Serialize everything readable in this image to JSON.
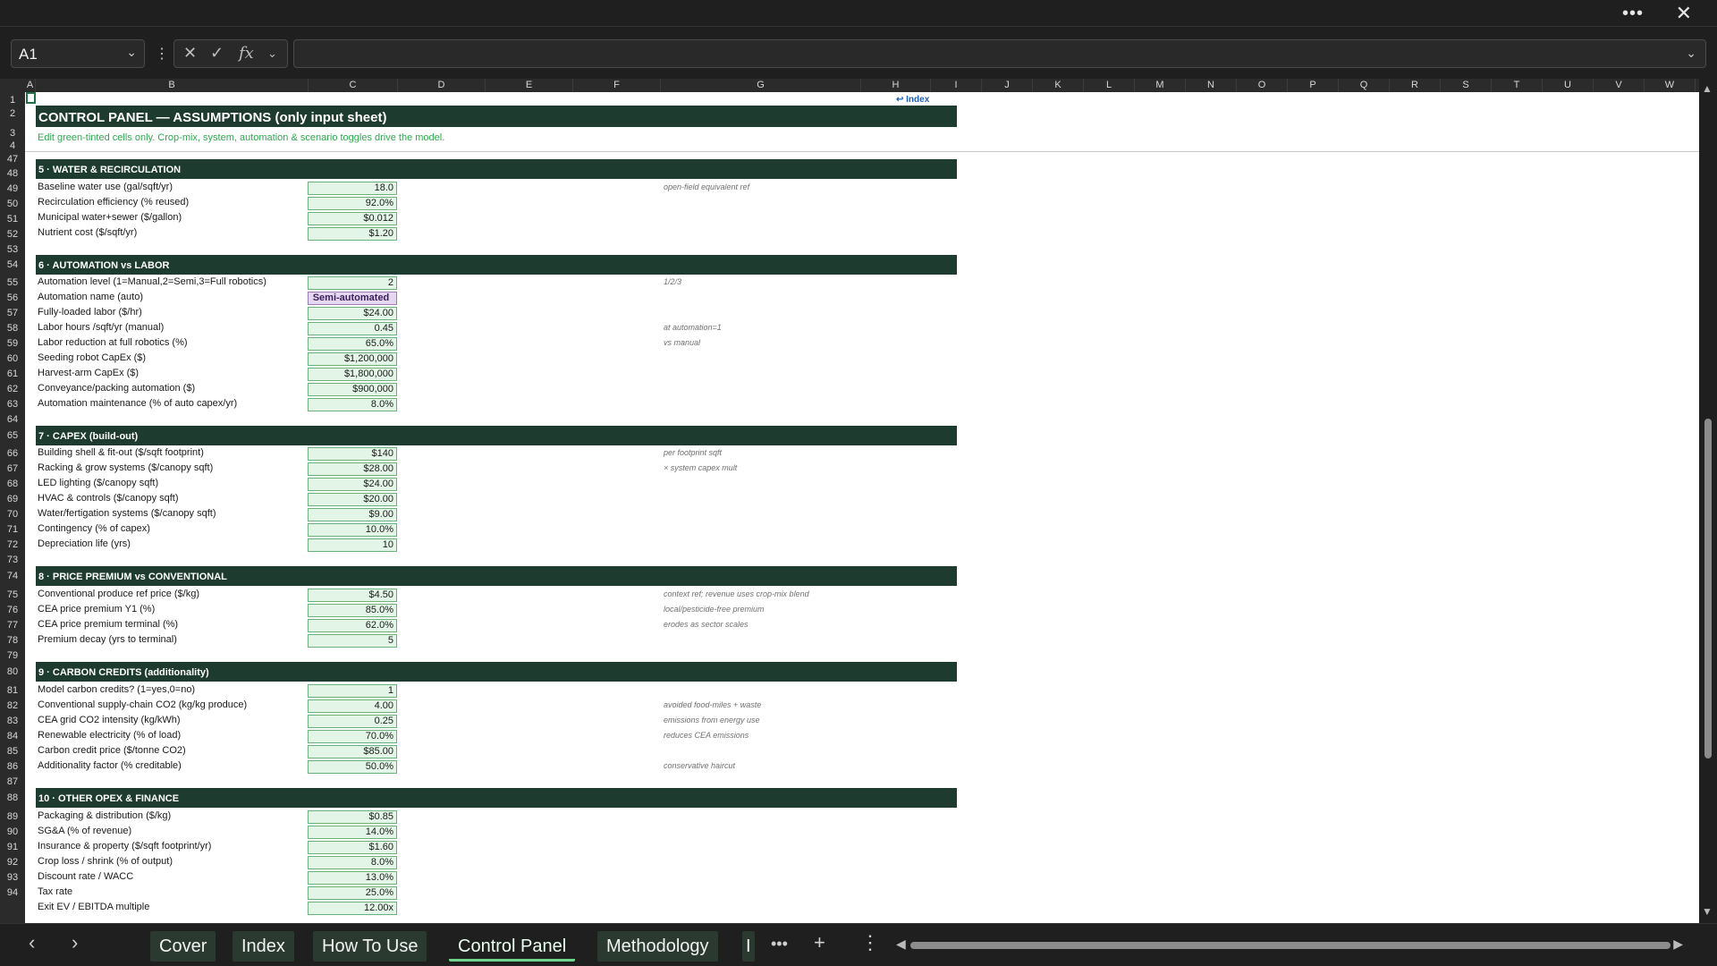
{
  "window": {
    "more_icon": "more-horizontal-icon",
    "close_icon": "close-icon"
  },
  "formula_bar": {
    "name_box": "A1",
    "formula": ""
  },
  "columns": [
    "A",
    "B",
    "C",
    "D",
    "E",
    "F",
    "G",
    "H",
    "I",
    "J",
    "K",
    "L",
    "M",
    "N",
    "O",
    "P",
    "Q",
    "R",
    "S",
    "T",
    "U",
    "V",
    "W"
  ],
  "rows": [
    "1",
    "2",
    "3",
    "4",
    "47",
    "48",
    "49",
    "50",
    "51",
    "52",
    "53",
    "54",
    "55",
    "56",
    "57",
    "58",
    "59",
    "60",
    "61",
    "62",
    "63",
    "64",
    "65",
    "66",
    "67",
    "68",
    "69",
    "70",
    "71",
    "72",
    "73",
    "74",
    "75",
    "76",
    "77",
    "78",
    "79",
    "80",
    "81",
    "82",
    "83",
    "84",
    "85",
    "86",
    "87",
    "88",
    "89",
    "90",
    "91",
    "92",
    "93",
    "94"
  ],
  "sheet": {
    "index_link": "↩ Index",
    "title": "CONTROL PANEL — ASSUMPTIONS (only input sheet)",
    "subtitle": "Edit green-tinted cells only. Crop-mix, system, automation & scenario toggles drive the model.",
    "s5": {
      "header": "5 · WATER & RECIRCULATION",
      "labels": [
        "Baseline water use (gal/sqft/yr)",
        "Recirculation efficiency (% reused)",
        "Municipal water+sewer ($/gallon)",
        "Nutrient cost ($/sqft/yr)"
      ],
      "values": [
        "18.0",
        "92.0%",
        "$0.012",
        "$1.20"
      ],
      "note1": "open-field equivalent ref"
    },
    "s6": {
      "header": "6 · AUTOMATION vs LABOR",
      "labels": [
        "Automation level (1=Manual,2=Semi,3=Full robotics)",
        "Automation name (auto)",
        "Fully-loaded labor ($/hr)",
        "Labor hours /sqft/yr (manual)",
        "Labor reduction at full robotics (%)",
        "Seeding robot CapEx ($)",
        "Harvest-arm CapEx ($)",
        "Conveyance/packing automation ($)",
        "Automation maintenance (% of auto capex/yr)"
      ],
      "values": [
        "2",
        "Semi-automated",
        "$24.00",
        "0.45",
        "65.0%",
        "$1,200,000",
        "$1,800,000",
        "$900,000",
        "8.0%"
      ],
      "notes": [
        "1/2/3",
        "at automation=1",
        "vs manual"
      ]
    },
    "s7": {
      "header": "7 · CAPEX (build-out)",
      "labels": [
        "Building shell & fit-out ($/sqft footprint)",
        "Racking & grow systems ($/canopy sqft)",
        "LED lighting ($/canopy sqft)",
        "HVAC & controls ($/canopy sqft)",
        "Water/fertigation systems ($/canopy sqft)",
        "Contingency (% of capex)",
        "Depreciation life (yrs)"
      ],
      "values": [
        "$140",
        "$28.00",
        "$24.00",
        "$20.00",
        "$9.00",
        "10.0%",
        "10"
      ],
      "notes": [
        "per footprint sqft",
        "× system capex mult"
      ]
    },
    "s8": {
      "header": "8 · PRICE PREMIUM vs CONVENTIONAL",
      "labels": [
        "Conventional produce ref price ($/kg)",
        "CEA price premium Y1 (%)",
        "CEA price premium terminal (%)",
        "Premium decay (yrs to terminal)"
      ],
      "values": [
        "$4.50",
        "85.0%",
        "62.0%",
        "5"
      ],
      "notes": [
        "context ref; revenue uses crop-mix blend",
        "local/pesticide-free premium",
        "erodes as sector scales"
      ]
    },
    "s9": {
      "header": "9 · CARBON CREDITS (additionality)",
      "labels": [
        "Model carbon credits? (1=yes,0=no)",
        "Conventional supply-chain CO2 (kg/kg produce)",
        "CEA grid CO2 intensity (kg/kWh)",
        "Renewable electricity (% of load)",
        "Carbon credit price ($/tonne CO2)",
        "Additionality factor (% creditable)"
      ],
      "values": [
        "1",
        "4.00",
        "0.25",
        "70.0%",
        "$85.00",
        "50.0%"
      ],
      "notes": [
        "avoided food-miles + waste",
        "emissions from energy use",
        "reduces CEA emissions",
        "conservative haircut"
      ]
    },
    "s10": {
      "header": "10 · OTHER OPEX & FINANCE",
      "labels": [
        "Packaging & distribution ($/kg)",
        "SG&A (% of revenue)",
        "Insurance & property ($/sqft footprint/yr)",
        "Crop loss / shrink (% of output)",
        "Discount rate / WACC",
        "Tax rate",
        "Exit EV / EBITDA multiple"
      ],
      "values": [
        "$0.85",
        "14.0%",
        "$1.60",
        "8.0%",
        "13.0%",
        "25.0%",
        "12.00x"
      ]
    }
  },
  "tabs": [
    "Cover",
    "Index",
    "How To Use",
    "Control Panel",
    "Methodology",
    "I"
  ],
  "active_tab": "Control Panel",
  "colors": {
    "section_bg": "#1d3b2f",
    "input_bg": "#e3f5e6",
    "auto_bg": "#e5d7f0",
    "subtitle": "#2fa84f"
  }
}
